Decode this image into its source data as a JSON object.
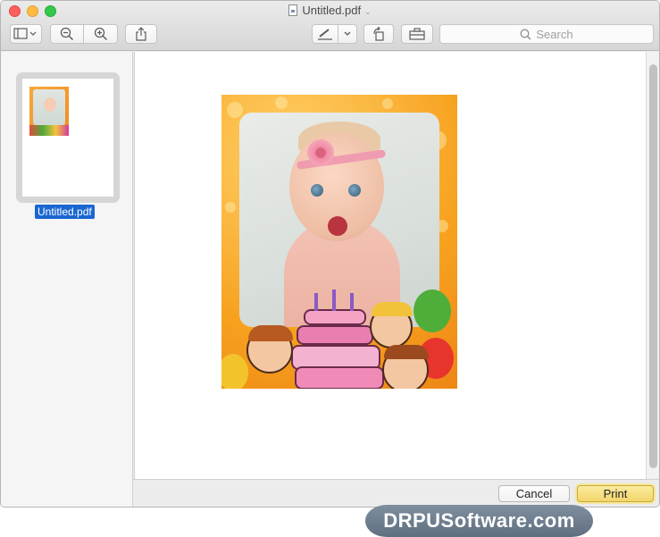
{
  "window": {
    "title": "Untitled.pdf",
    "title_menu_icon": "chevron-down-icon",
    "document_icon": "pdf-document-icon"
  },
  "toolbar": {
    "items": [
      {
        "name": "sidebar-toggle-button",
        "icon": "sidebar-icon"
      },
      {
        "name": "zoom-out-button",
        "icon": "zoom-out-icon"
      },
      {
        "name": "zoom-in-button",
        "icon": "zoom-in-icon"
      },
      {
        "name": "share-button",
        "icon": "share-icon"
      },
      {
        "name": "markup-button",
        "icon": "pen-icon"
      },
      {
        "name": "rotate-button",
        "icon": "rotate-icon"
      },
      {
        "name": "toolbox-button",
        "icon": "toolbox-icon"
      }
    ],
    "search_placeholder": "Search"
  },
  "sidebar": {
    "thumbnails": [
      {
        "label": "Untitled.pdf",
        "selected": true
      }
    ]
  },
  "actions": {
    "cancel_label": "Cancel",
    "print_label": "Print"
  },
  "watermark": {
    "text": "DRPUSoftware.com"
  },
  "colors": {
    "selection": "#1a66d2",
    "print_button": "#f2d56c",
    "card_frame": "#f7a21f"
  }
}
